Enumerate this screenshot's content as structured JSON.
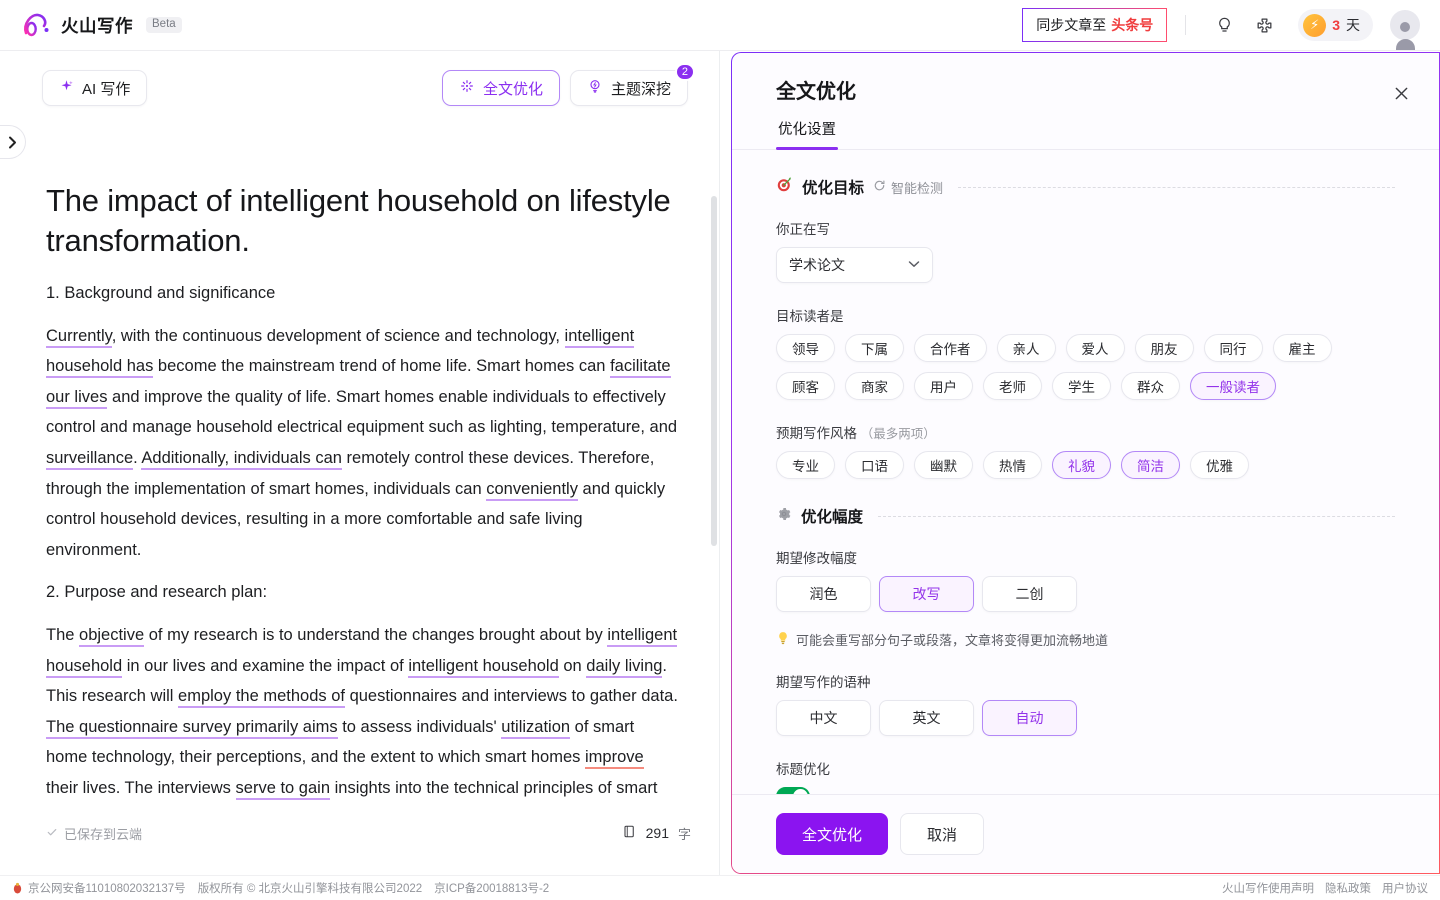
{
  "header": {
    "brand_name": "火山写作",
    "beta_label": "Beta",
    "sync_button": {
      "text": "同步文章至",
      "accent": "头条号"
    },
    "bulb_icon": "lightbulb-icon",
    "puzzle_icon": "puzzle-icon",
    "days_value": "3",
    "days_unit": "天"
  },
  "toolbar": {
    "ai_write": "AI 写作",
    "full_optimize": "全文优化",
    "topic_dig": "主题深挖",
    "topic_dig_badge": "2"
  },
  "document": {
    "title": "The impact of intelligent household on lifestyle transformation.",
    "heading1": "1. Background and significance",
    "para1": [
      {
        "t": "Currently",
        "u": "purple"
      },
      {
        "t": ", with the continuous development of science and technology, "
      },
      {
        "t": "intelligent household has",
        "u": "purple"
      },
      {
        "t": " become the mainstream trend of home life. Smart homes can "
      },
      {
        "t": "facilitate our lives",
        "u": "purple"
      },
      {
        "t": " and improve the quality of life. Smart homes enable individuals to effectively control and manage household electrical equipment such as lighting, temperature, and "
      },
      {
        "t": "surveillance",
        "u": "purple"
      },
      {
        "t": ". "
      },
      {
        "t": "Additionally, individuals can",
        "u": "purple"
      },
      {
        "t": " remotely control these devices. Therefore, through the implementation of smart homes, individuals can "
      },
      {
        "t": "conveniently",
        "u": "purple"
      },
      {
        "t": " and quickly control household devices, resulting in a more comfortable and safe living environment."
      }
    ],
    "heading2": "2. Purpose and research plan:",
    "para2": [
      {
        "t": "The "
      },
      {
        "t": "objective",
        "u": "purple"
      },
      {
        "t": " of my research is to understand the changes brought about by "
      },
      {
        "t": "intelligent household",
        "u": "purple"
      },
      {
        "t": " in our lives and examine the impact of "
      },
      {
        "t": "intelligent household",
        "u": "purple"
      },
      {
        "t": " on "
      },
      {
        "t": "daily living",
        "u": "purple"
      },
      {
        "t": ". This research will "
      },
      {
        "t": "employ the methods of",
        "u": "purple"
      },
      {
        "t": " questionnaires and interviews to gather data. "
      },
      {
        "t": "The questionnaire survey primarily aims",
        "u": "purple"
      },
      {
        "t": " to assess individuals' "
      },
      {
        "t": "utilization",
        "u": "purple"
      },
      {
        "t": " of smart home technology, their perceptions, and the extent to which smart homes "
      },
      {
        "t": "improve",
        "u": "red"
      },
      {
        "t": " their lives. The interviews "
      },
      {
        "t": "serve to gain",
        "u": "purple"
      },
      {
        "t": " insights into the technical principles of smart"
      }
    ]
  },
  "status": {
    "saved_text": "已保存到云端",
    "word_count": "291",
    "word_unit": "字"
  },
  "footer": {
    "icp_police": "京公网安备11010802032137号",
    "copyright": "版权所有 © 北京火山引擎科技有限公司2022",
    "icp": "京ICP备20018813号-2",
    "links": [
      "火山写作使用声明",
      "隐私政策",
      "用户协议"
    ]
  },
  "panel": {
    "title": "全文优化",
    "close_icon": "close-icon",
    "tabs": [
      {
        "label": "优化设置",
        "active": true
      }
    ],
    "section_goal": {
      "icon": "target-icon",
      "title": "优化目标",
      "sub_icon": "refresh-icon",
      "sub_label": "智能检测"
    },
    "writing_type": {
      "label": "你正在写",
      "value": "学术论文",
      "caret_icon": "chevron-down-icon"
    },
    "audience": {
      "label": "目标读者是",
      "options": [
        {
          "label": "领导",
          "selected": false
        },
        {
          "label": "下属",
          "selected": false
        },
        {
          "label": "合作者",
          "selected": false
        },
        {
          "label": "亲人",
          "selected": false
        },
        {
          "label": "爱人",
          "selected": false
        },
        {
          "label": "朋友",
          "selected": false
        },
        {
          "label": "同行",
          "selected": false
        },
        {
          "label": "雇主",
          "selected": false
        },
        {
          "label": "顾客",
          "selected": false
        },
        {
          "label": "商家",
          "selected": false
        },
        {
          "label": "用户",
          "selected": false
        },
        {
          "label": "老师",
          "selected": false
        },
        {
          "label": "学生",
          "selected": false
        },
        {
          "label": "群众",
          "selected": false
        },
        {
          "label": "一般读者",
          "selected": true
        }
      ]
    },
    "style": {
      "label": "预期写作风格",
      "hint": "（最多两项）",
      "options": [
        {
          "label": "专业",
          "selected": false
        },
        {
          "label": "口语",
          "selected": false
        },
        {
          "label": "幽默",
          "selected": false
        },
        {
          "label": "热情",
          "selected": false
        },
        {
          "label": "礼貌",
          "selected": true
        },
        {
          "label": "简洁",
          "selected": true
        },
        {
          "label": "优雅",
          "selected": false
        }
      ]
    },
    "section_amplitude": {
      "icon": "gear-icon",
      "title": "优化幅度"
    },
    "amplitude": {
      "label": "期望修改幅度",
      "options": [
        {
          "label": "润色",
          "selected": false
        },
        {
          "label": "改写",
          "selected": true
        },
        {
          "label": "二创",
          "selected": false
        }
      ],
      "tip_icon": "bulb-icon",
      "tip": "可能会重写部分句子或段落，文章将变得更加流畅地道"
    },
    "language": {
      "label": "期望写作的语种",
      "options": [
        {
          "label": "中文",
          "selected": false
        },
        {
          "label": "英文",
          "selected": false
        },
        {
          "label": "自动",
          "selected": true
        }
      ]
    },
    "title_optimize": {
      "label": "标题优化",
      "enabled": true
    },
    "actions": {
      "primary": "全文优化",
      "cancel": "取消"
    }
  },
  "colors": {
    "accent_purple": "#8b2ff0",
    "accent_red": "#f03d3e",
    "chip_selected_border": "#b388f7",
    "switch_on": "#00a854",
    "underline_purple": "#c99cf5",
    "underline_red": "#f58b7e"
  }
}
